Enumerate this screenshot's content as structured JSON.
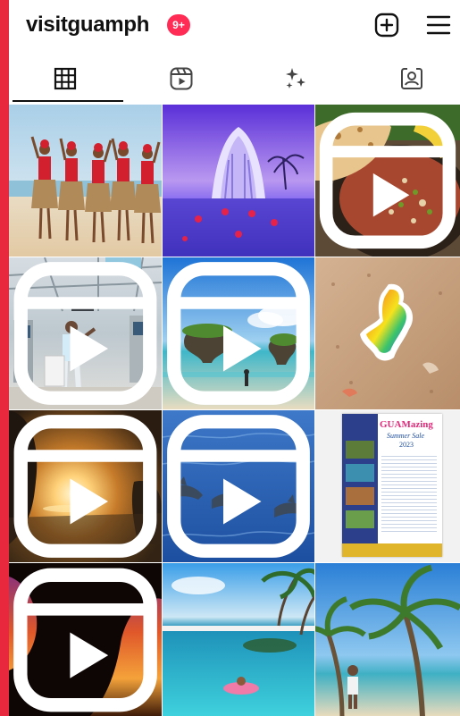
{
  "profile": {
    "username": "visitguamph",
    "notification_badge": "9+"
  },
  "header_icons": [
    "plus-square-icon",
    "menu-icon"
  ],
  "tabs": [
    {
      "name": "posts-grid-icon",
      "active": true
    },
    {
      "name": "reels-icon",
      "active": false
    },
    {
      "name": "sparkle-icon",
      "active": false
    },
    {
      "name": "tagged-icon",
      "active": false
    }
  ],
  "posts": [
    {
      "subject": "chamorro-dancers",
      "is_reel": false
    },
    {
      "subject": "glass-chapel",
      "is_reel": false
    },
    {
      "subject": "kelaguen-flatbread",
      "is_reel": true
    },
    {
      "subject": "airport-traveler",
      "is_reel": true
    },
    {
      "subject": "rock-islands-beach",
      "is_reel": true
    },
    {
      "subject": "guam-map-sticker",
      "is_reel": false
    },
    {
      "subject": "sunset-car",
      "is_reel": true
    },
    {
      "subject": "dolphins",
      "is_reel": true
    },
    {
      "subject": "guamazing-poster",
      "is_reel": false
    },
    {
      "subject": "cave-sunset",
      "is_reel": true
    },
    {
      "subject": "pool-palms",
      "is_reel": false
    },
    {
      "subject": "palm-beach-kid",
      "is_reel": false
    }
  ],
  "poster_text": {
    "title": "GUAMazing",
    "subtitle": "Summer Sale",
    "year": "2023"
  },
  "colors": {
    "frame": "#e8283c",
    "badge": "#ff2d55"
  }
}
